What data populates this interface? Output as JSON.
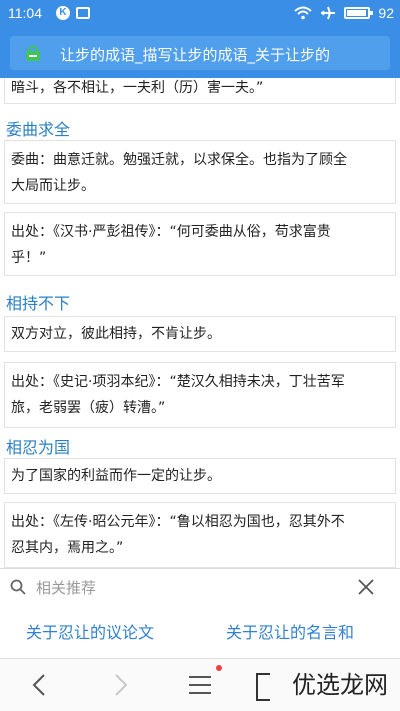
{
  "status_bar": {
    "time": "11:04",
    "battery": "92",
    "battery_level": 0.92
  },
  "title_bar": {
    "title": "让步的成语_描写让步的成语_关于让步的"
  },
  "content": {
    "top_fragment": "暗斗，各不相让，一夫利（历）害一夫。”",
    "sections": [
      {
        "heading": "委曲求全",
        "meaning": [
          "委曲：曲意迁就。勉强迁就，以求保全。也指为了顾全",
          "大局而让步。"
        ],
        "source": [
          "出处：《汉书·严彭祖传》：“何可委曲从俗，苟求富贵",
          "乎！”"
        ]
      },
      {
        "heading": "相持不下",
        "meaning": [
          "双方对立，彼此相持，不肯让步。"
        ],
        "source": [
          "出处：《史记·项羽本纪》：“楚汉久相持未决，丁壮苦军",
          "旅，老弱罢（疲）转漕。”"
        ]
      },
      {
        "heading": "相忍为国",
        "meaning": [
          "为了国家的利益而作一定的让步。"
        ],
        "source": [
          "出处：《左传·昭公元年》：“鲁以相忍为国也，忍其外不",
          "忍其内，焉用之。”"
        ]
      }
    ]
  },
  "recommend": {
    "title": "相关推荐",
    "links": [
      "关于忍让的议论文",
      "关于忍让的名言和"
    ]
  },
  "watermark": "优选龙网",
  "colors": {
    "accent": "#3a8ee6",
    "link": "#2f7fd2",
    "heading": "#2a7fc5"
  }
}
